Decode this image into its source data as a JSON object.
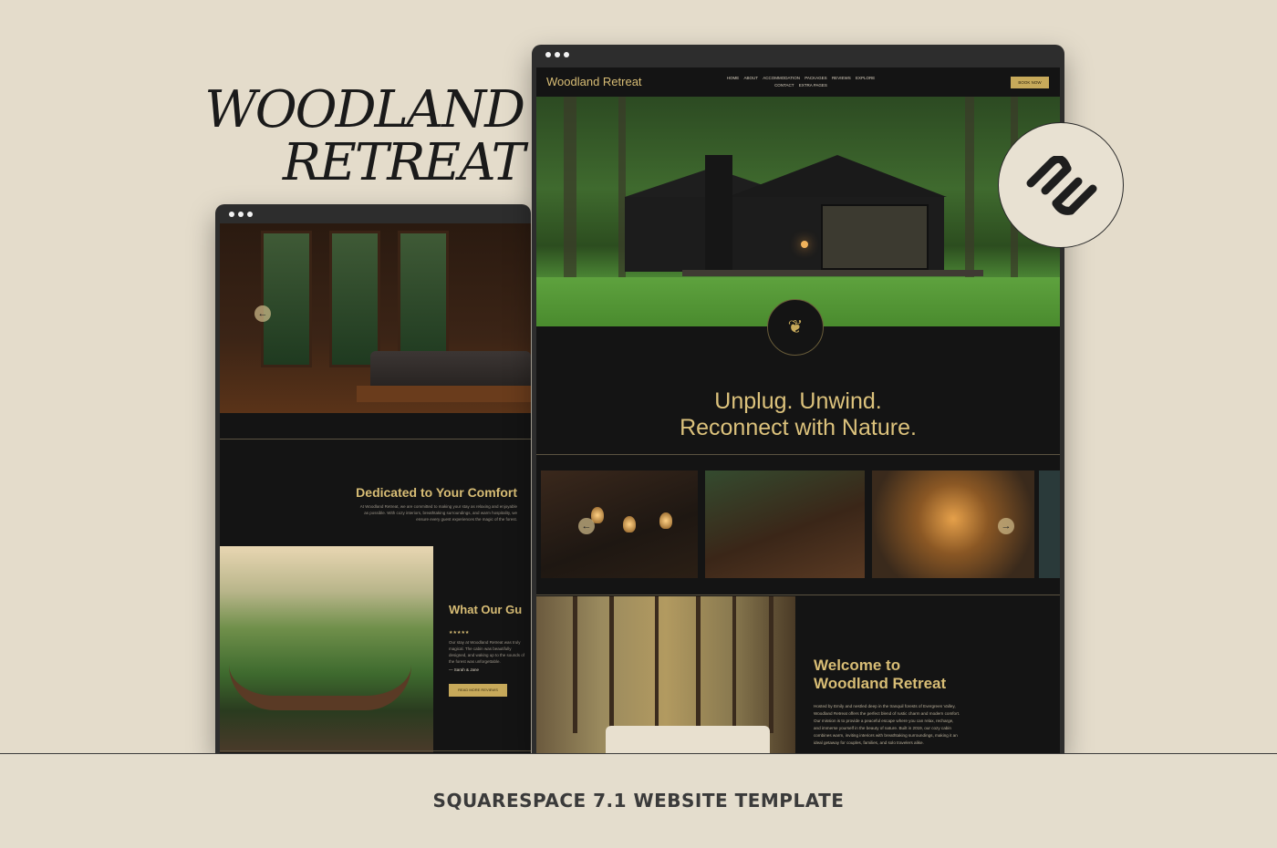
{
  "heading": {
    "line1": "WOODLAND",
    "line2": "RETREAT"
  },
  "footer": {
    "label": "SQUARESPACE 7.1 WEBSITE TEMPLATE"
  },
  "left_screen": {
    "section_title": "Dedicated to Your Comfort",
    "section_body": "At Woodland Retreat, we are committed to making your stay as relaxing and enjoyable as possible. With cozy interiors, breathtaking surroundings, and warm hospitality, we ensure every guest experiences the magic of the forest.",
    "testimonial_title": "What Our Gu",
    "stars": "★★★★★",
    "testimonial_body": "Our stay at Woodland Retreat was truly magical. The cabin was beautifully designed, and waking up to the sounds of the forest was unforgettable.",
    "testimonial_author": "— Sarah & Jane",
    "read_more": "READ MORE REVIEWS",
    "prev_arrow": "←"
  },
  "right_screen": {
    "logo": "Woodland Retreat",
    "nav_row1": [
      "HOME",
      "ABOUT",
      "ACCOMMODATION",
      "PACKAGES",
      "REVIEWS",
      "EXPLORE"
    ],
    "nav_row2": [
      "CONTACT",
      "EXTRA PAGES"
    ],
    "book_now": "BOOK NOW",
    "emblem_icon": "tree-icon",
    "emblem_glyph": "❦",
    "tagline_line1": "Unplug. Unwind.",
    "tagline_line2": "Reconnect with Nature.",
    "gallery_prev": "←",
    "gallery_next": "→",
    "welcome_title_line1": "Welcome to",
    "welcome_title_line2": "Woodland Retreat",
    "welcome_body": "Hosted by Emily and nestled deep in the tranquil forests of Evergreen Valley, Woodland Retreat offers the perfect blend of rustic charm and modern comfort. Our mission is to provide a peaceful escape where you can relax, recharge, and immerse yourself in the beauty of nature. Built in 2019, our cozy cabin combines warm, inviting interiors with breathtaking surroundings, making it an ideal getaway for couples, families, and solo travelers alike."
  },
  "colors": {
    "accent": "#d8bd75",
    "background": "#e4dccb",
    "screen": "#141414"
  },
  "badge": {
    "icon": "squarespace-logo-icon"
  }
}
